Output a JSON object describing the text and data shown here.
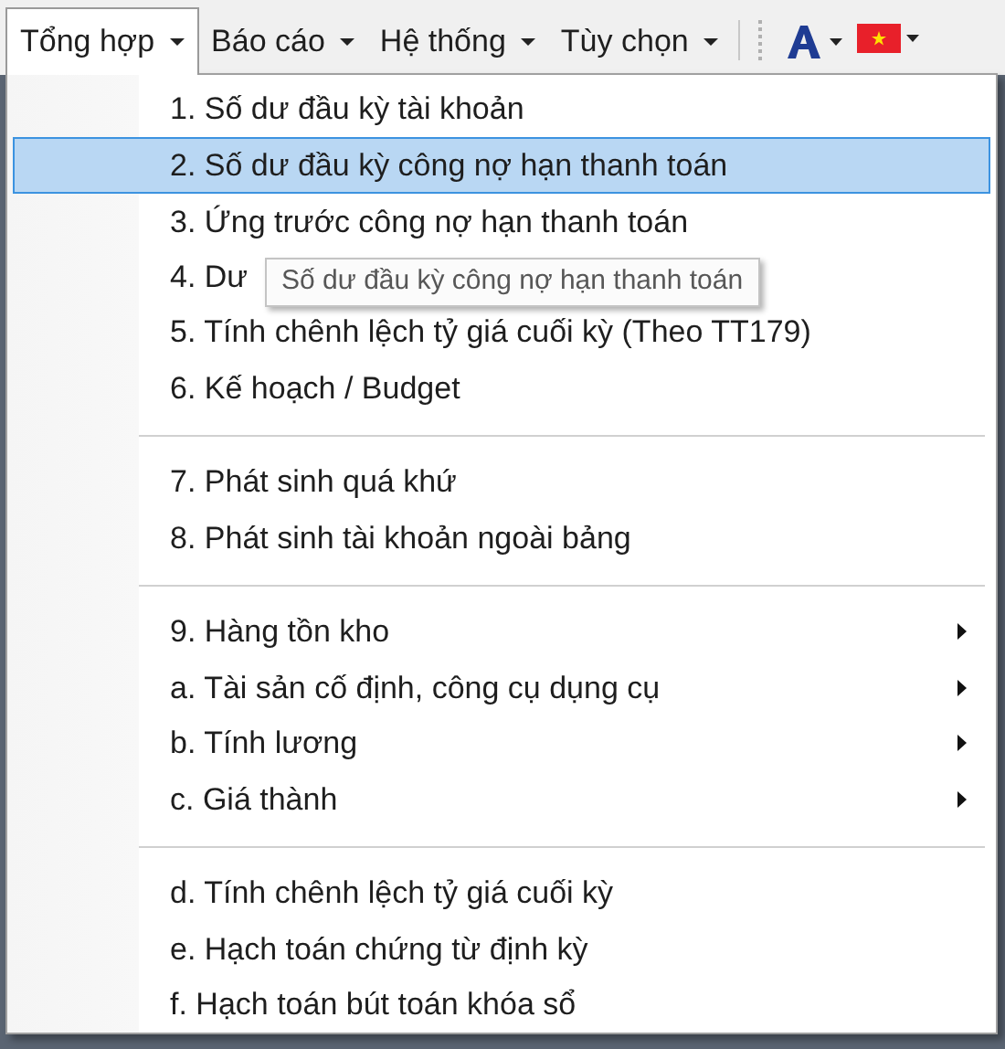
{
  "menubar": {
    "items": [
      {
        "label": "Tổng hợp",
        "selected": true
      },
      {
        "label": "Báo cáo",
        "selected": false
      },
      {
        "label": "Hệ thống",
        "selected": false
      },
      {
        "label": "Tùy chọn",
        "selected": false
      }
    ]
  },
  "menu": {
    "groups": [
      [
        {
          "label": "1. Số dư đầu kỳ tài khoản",
          "selected": false,
          "has_submenu": false
        },
        {
          "label": "2. Số dư đầu kỳ công nợ hạn thanh toán",
          "selected": true,
          "has_submenu": false
        },
        {
          "label": "3. Ứng trước công nợ hạn thanh toán",
          "selected": false,
          "has_submenu": false
        },
        {
          "label": "4. Dư",
          "selected": false,
          "has_submenu": false
        },
        {
          "label": "5. Tính chênh lệch tỷ giá cuối kỳ (Theo TT179)",
          "selected": false,
          "has_submenu": false
        },
        {
          "label": "6. Kế hoạch / Budget",
          "selected": false,
          "has_submenu": false
        }
      ],
      [
        {
          "label": "7. Phát sinh quá khứ",
          "selected": false,
          "has_submenu": false
        },
        {
          "label": "8. Phát sinh tài khoản ngoài bảng",
          "selected": false,
          "has_submenu": false
        }
      ],
      [
        {
          "label": "9. Hàng tồn kho",
          "selected": false,
          "has_submenu": true
        },
        {
          "label": "a. Tài sản cố định, công cụ dụng cụ",
          "selected": false,
          "has_submenu": true
        },
        {
          "label": "b. Tính lương",
          "selected": false,
          "has_submenu": true
        },
        {
          "label": "c. Giá thành",
          "selected": false,
          "has_submenu": true
        }
      ],
      [
        {
          "label": "d. Tính chênh lệch tỷ giá cuối kỳ",
          "selected": false,
          "has_submenu": false
        },
        {
          "label": "e. Hạch toán chứng từ định kỳ",
          "selected": false,
          "has_submenu": false
        },
        {
          "label": "f. Hạch toán bút toán khóa sổ",
          "selected": false,
          "has_submenu": false
        }
      ]
    ]
  },
  "tooltip": {
    "text": "Số dư đầu kỳ công nợ hạn thanh toán"
  }
}
